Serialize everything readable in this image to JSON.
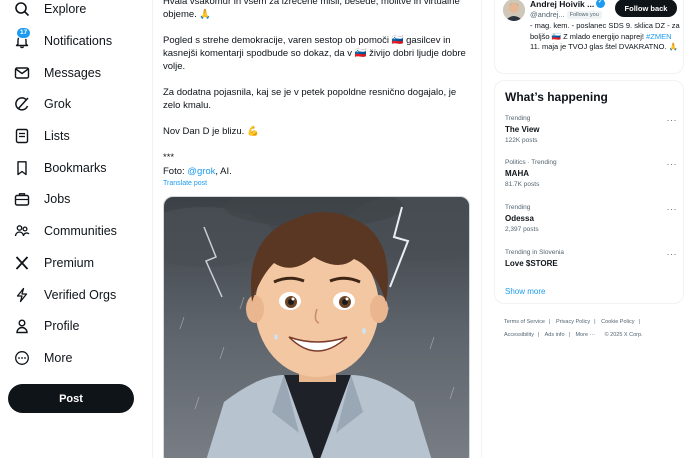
{
  "nav": {
    "items": [
      {
        "label": "Explore",
        "icon": "search-icon"
      },
      {
        "label": "Notifications",
        "icon": "bell-icon",
        "badge": "17"
      },
      {
        "label": "Messages",
        "icon": "envelope-icon"
      },
      {
        "label": "Grok",
        "icon": "grok-icon"
      },
      {
        "label": "Lists",
        "icon": "list-icon"
      },
      {
        "label": "Bookmarks",
        "icon": "bookmark-icon"
      },
      {
        "label": "Jobs",
        "icon": "briefcase-icon"
      },
      {
        "label": "Communities",
        "icon": "people-icon"
      },
      {
        "label": "Premium",
        "icon": "x-logo-icon"
      },
      {
        "label": "Verified Orgs",
        "icon": "lightning-icon"
      },
      {
        "label": "Profile",
        "icon": "person-icon"
      },
      {
        "label": "More",
        "icon": "more-circle-icon"
      }
    ],
    "post_label": "Post"
  },
  "post": {
    "para1": "Hvala vsakomur in vsem za izrečene misli, besede, molitve in virtualne objeme. 🙏",
    "para2_a": "Pogled s strehe demokracije, varen sestop ob pomoči ",
    "para2_b": " gasilcev in kasnejši komentarji spodbude so dokaz, da v ",
    "para2_c": " živijo dobri ljudje dobre volje.",
    "para3": "Za dodatna pojasnila, kaj se je v petek popoldne resnično dogajalo, je zelo kmalu.",
    "para4": "Nov Dan D je blizu. 💪",
    "para5": "***",
    "photo_prefix": "Foto: ",
    "photo_link": "@grok",
    "photo_suffix": ", AI.",
    "translate": "Translate post"
  },
  "profile_card": {
    "name": "Andrej Hoivik ...",
    "handle": "@andrej...",
    "follows_you": "Follows you",
    "follow_back": "Follow back",
    "bio_a": "- mag. kem. - poslanec SDS 9. sklica DZ - za boljšo ",
    "bio_b": " Z mlado energijo naprej! ",
    "bio_hashtag": "#ZMEN",
    "bio_c": " 11. maja je TVOJ glas štel DVAKRATNO. 🙏"
  },
  "happening": {
    "title": "What’s happening",
    "trends": [
      {
        "meta": "Trending",
        "title": "The View",
        "count": "122K posts"
      },
      {
        "meta": "Politics · Trending",
        "title": "MAHA",
        "count": "81.7K posts"
      },
      {
        "meta": "Trending",
        "title": "Odessa",
        "count": "2,397 posts"
      },
      {
        "meta": "Trending in Slovenia",
        "title": "Love $STORE",
        "count": ""
      }
    ],
    "more_glyph": "···",
    "show_more": "Show more"
  },
  "footer": {
    "links": [
      "Terms of Service",
      "Privacy Policy",
      "Cookie Policy",
      "Accessibility",
      "Ads info",
      "More ···"
    ],
    "copyright": "© 2025 X Corp."
  },
  "colors": {
    "accent": "#1d9bf0",
    "text": "#0f1419",
    "muted": "#536471",
    "button": "#0f1419"
  }
}
